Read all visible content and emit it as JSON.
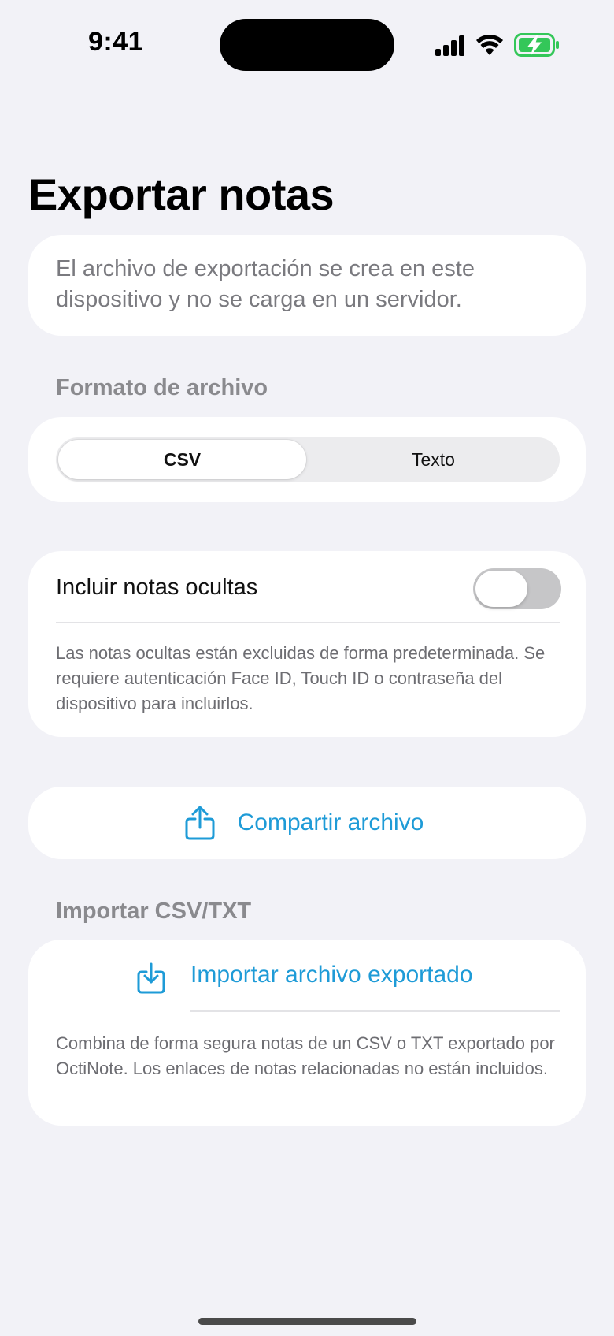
{
  "status_bar": {
    "time": "9:41",
    "icons": [
      "cellular-signal-icon",
      "wifi-icon",
      "battery-charging-icon"
    ],
    "battery_color": "#34c759"
  },
  "page": {
    "title": "Exportar notas",
    "intro": "El archivo de exportación se crea en este dispositivo y no se carga en un servidor."
  },
  "format": {
    "header": "Formato de archivo",
    "options": [
      {
        "label": "CSV",
        "selected": true
      },
      {
        "label": "Texto",
        "selected": false
      }
    ]
  },
  "hidden_notes": {
    "label": "Incluir notas ocultas",
    "enabled": false,
    "note": "Las notas ocultas están excluidas de forma predeterminada. Se requiere autenticación Face ID, Touch ID o contraseña del dispositivo para incluirlos."
  },
  "share": {
    "label": "Compartir archivo",
    "icon": "share-icon"
  },
  "import": {
    "header": "Importar CSV/TXT",
    "label": "Importar archivo exportado",
    "icon": "import-icon",
    "note": "Combina de forma segura notas de un CSV o TXT exportado por OctiNote. Los enlaces de notas relacionadas no están incluidos."
  },
  "colors": {
    "accent": "#1e9bd7",
    "background": "#f2f2f7",
    "toggle_off": "#c6c6c8"
  }
}
